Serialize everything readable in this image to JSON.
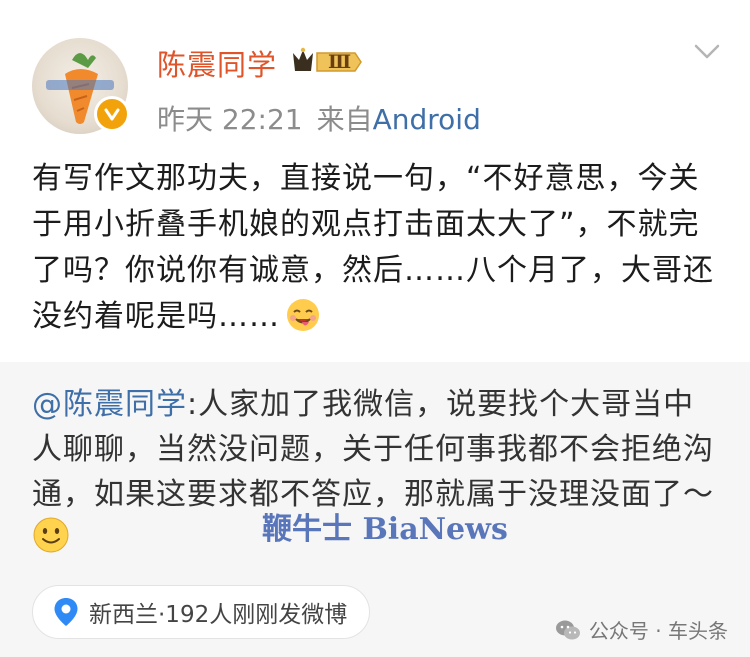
{
  "post": {
    "username": "陈震同学",
    "vip_level": "Ⅲ",
    "time": "昨天 22:21",
    "source_prefix": "来自",
    "source_device": "Android",
    "content": "有写作文那功夫，直接说一句，“不好意思，今关于用小折叠手机娘的观点打击面太大了”，不就完了吗？你说你有诚意，然后……八个月了，大哥还没约着呢是吗……"
  },
  "repost": {
    "mention": "@陈震同学",
    "text": ":人家加了我微信，说要找个大哥当中人聊聊，当然没问题，关于任何事我都不会拒绝沟通，如果这要求都不答应，那就属于没理没面了～",
    "watermark": "鞭牛士 BiaNews"
  },
  "location": {
    "text": "新西兰·192人刚刚发微博"
  },
  "footer": {
    "source": "公众号 · 车头条"
  },
  "colors": {
    "username": "#e0542a",
    "link": "#3f6fa8",
    "meta": "#8c8c8c",
    "repost_bg": "#f6f6f6",
    "location_icon": "#2f8af5"
  }
}
